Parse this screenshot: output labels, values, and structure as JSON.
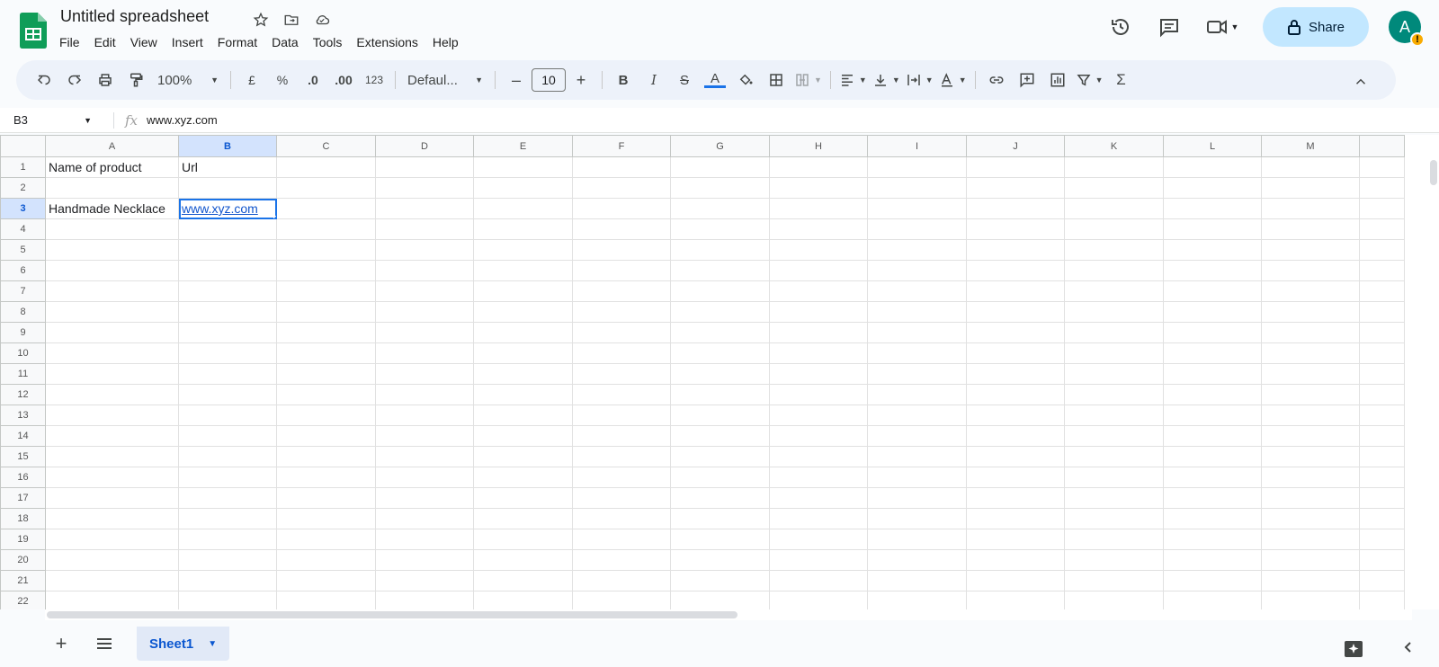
{
  "app": {
    "title": "Untitled spreadsheet",
    "menu": [
      "File",
      "Edit",
      "View",
      "Insert",
      "Format",
      "Data",
      "Tools",
      "Extensions",
      "Help"
    ],
    "share_label": "Share",
    "avatar_letter": "A",
    "avatar_badge": "!"
  },
  "toolbar": {
    "zoom": "100%",
    "currency": "£",
    "percent": "%",
    "decrease_decimal": ".0",
    "increase_decimal": ".00",
    "number_format": "123",
    "font": "Defaul...",
    "font_size": "10",
    "minus": "–",
    "plus": "+",
    "bold": "B",
    "italic": "I",
    "strike": "S",
    "text_color": "A",
    "sum": "Σ"
  },
  "formula_bar": {
    "name_box": "B3",
    "fx": "fx",
    "formula": "www.xyz.com"
  },
  "columns": [
    "A",
    "B",
    "C",
    "D",
    "E",
    "F",
    "G",
    "H",
    "I",
    "J",
    "K",
    "L",
    "M"
  ],
  "rows": [
    "1",
    "2",
    "3",
    "4",
    "5",
    "6",
    "7",
    "8",
    "9",
    "10",
    "11",
    "12",
    "13",
    "14",
    "15",
    "16",
    "17",
    "18",
    "19",
    "20",
    "21",
    "22"
  ],
  "cells": {
    "A1": "Name of product",
    "B1": "Url",
    "A3": "Handmade Necklace",
    "B3": "www.xyz.com"
  },
  "selection": {
    "cell": "B3",
    "column": "B",
    "row": "3"
  },
  "sheets": [
    {
      "name": "Sheet1",
      "active": true
    }
  ],
  "colors": {
    "accent": "#1a73e8",
    "share_bg": "#c2e7ff",
    "logo_green": "#0f9d58",
    "link": "#1155cc"
  }
}
